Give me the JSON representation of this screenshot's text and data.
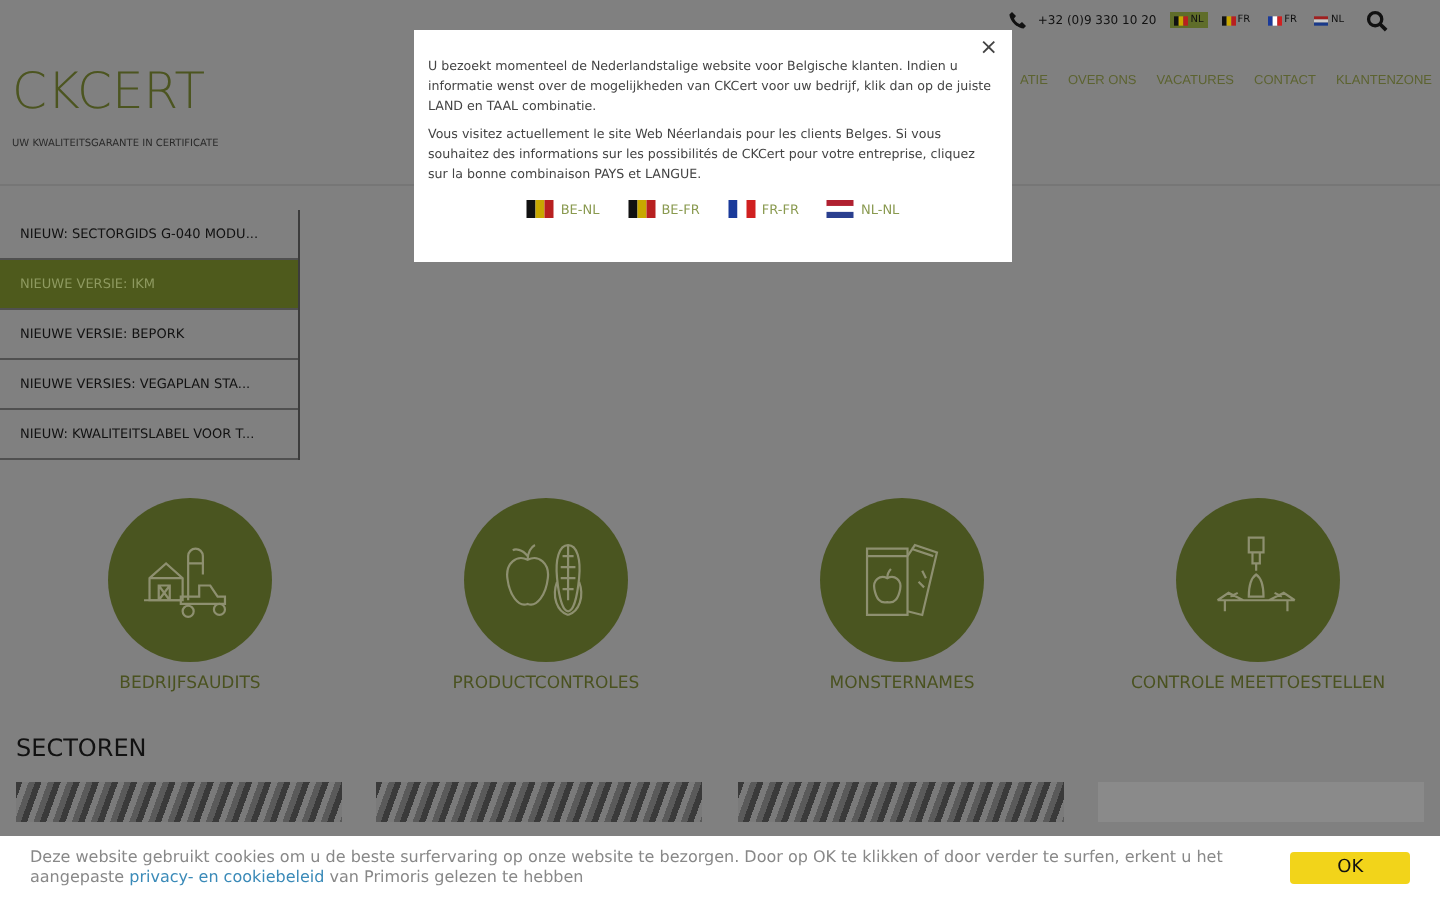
{
  "top_bar": {
    "phone": "+32 (0)9 330 10 20",
    "languages": [
      {
        "label": "NL",
        "kind": "be",
        "selected": true
      },
      {
        "label": "FR",
        "kind": "be",
        "selected": false
      },
      {
        "label": "FR",
        "kind": "fr",
        "selected": false
      },
      {
        "label": "NL",
        "kind": "nl",
        "selected": false
      }
    ]
  },
  "logo": {
    "name": "CKCERT",
    "tagline": "UW KWALITEITSGARANTE IN CERTIFICATE"
  },
  "nav": [
    "ATIE",
    "OVER ONS",
    "VACATURES",
    "CONTACT",
    "KLANTENZONE"
  ],
  "news": [
    {
      "label": "NIEUW: SECTORGIDS G-040 MODU...",
      "selected": false
    },
    {
      "label": "NIEUWE VERSIE: IKM",
      "selected": true
    },
    {
      "label": "NIEUWE VERSIE: BEPORK",
      "selected": false
    },
    {
      "label": "NIEUWE VERSIES: VEGAPLAN STA...",
      "selected": false
    },
    {
      "label": "NIEUW: KWALITEITSLABEL VOOR T...",
      "selected": false
    }
  ],
  "services": [
    {
      "label": "BEDRIJFSAUDITS",
      "kind": "farm"
    },
    {
      "label": "PRODUCTCONTROLES",
      "kind": "produce"
    },
    {
      "label": "MONSTERNAMES",
      "kind": "samples"
    },
    {
      "label": "CONTROLE MEETTOESTELLEN",
      "kind": "measuring"
    }
  ],
  "sectors": {
    "title": "SECTOREN"
  },
  "cookie": {
    "text": "Deze website gebruikt cookies om u de beste surfervaring op onze website te bezorgen. Door op OK te klikken of door verder te surfen, erkent u het aangepaste ",
    "link": "privacy- en cookiebeleid",
    "text_after": " van Primoris gelezen te hebben",
    "button": "OK"
  },
  "modal": {
    "close": "×",
    "paragraphs": [
      "U bezoekt momenteel de Nederlandstalige website voor Belgische klanten. Indien u informatie wenst over de mogelijkheden van CKCert voor uw bedrijf, klik dan op de juiste LAND en TAAL combinatie.",
      "Vous visitez actuellement le site Web Néerlandais pour les clients Belges. Si vous souhaitez des informations sur les possibilités de CKCert pour votre entreprise, cliquez sur la bonne combinaison PAYS et LANGUE."
    ],
    "options": [
      {
        "label": "BE-NL",
        "kind": "be"
      },
      {
        "label": "BE-FR",
        "kind": "be"
      },
      {
        "label": "FR-FR",
        "kind": "fr"
      },
      {
        "label": "NL-NL",
        "kind": "nl"
      }
    ]
  }
}
